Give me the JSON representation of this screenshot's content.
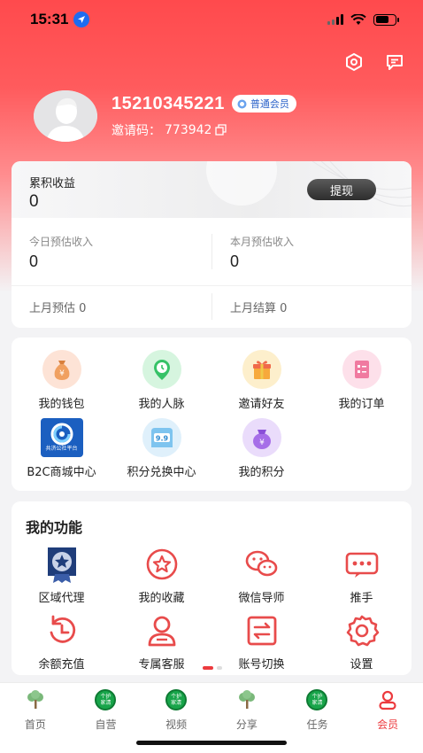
{
  "status_bar": {
    "time": "15:31"
  },
  "profile": {
    "phone": "15210345221",
    "member_level": "普通会员",
    "invite_label": "邀请码：",
    "invite_code": "773942"
  },
  "earnings": {
    "total_label": "累积收益",
    "total_value": "0",
    "withdraw_label": "提现",
    "today_label": "今日预估收入",
    "today_value": "0",
    "month_label": "本月预估收入",
    "month_value": "0",
    "last_month_estimate": "上月预估 0",
    "last_month_settled": "上月结算 0"
  },
  "menu": {
    "items": [
      {
        "label": "我的钱包",
        "icon": "money-bag-icon"
      },
      {
        "label": "我的人脉",
        "icon": "clock-pin-icon"
      },
      {
        "label": "邀请好友",
        "icon": "gift-icon"
      },
      {
        "label": "我的订单",
        "icon": "order-list-icon"
      },
      {
        "label": "B2C商城中心",
        "icon": "mall-logo-icon",
        "logo_text": "共济公社平台"
      },
      {
        "label": "积分兑换中心",
        "icon": "points-tag-icon",
        "tag_text": "9.9"
      },
      {
        "label": "我的积分",
        "icon": "points-bag-icon"
      }
    ]
  },
  "functions": {
    "title": "我的功能",
    "items": [
      {
        "label": "区域代理",
        "icon": "agent-medal-icon"
      },
      {
        "label": "我的收藏",
        "icon": "star-icon"
      },
      {
        "label": "微信导师",
        "icon": "wechat-icon"
      },
      {
        "label": "推手",
        "icon": "promoter-icon"
      },
      {
        "label": "余额充值",
        "icon": "recharge-icon"
      },
      {
        "label": "专属客服",
        "icon": "service-icon"
      },
      {
        "label": "账号切换",
        "icon": "switch-account-icon"
      },
      {
        "label": "设置",
        "icon": "gear-icon"
      }
    ]
  },
  "tabbar": {
    "tabs": [
      {
        "label": "首页",
        "icon": "tree-icon",
        "active": false
      },
      {
        "label": "自营",
        "icon": "green-badge-icon",
        "badge_text": "个护家清",
        "active": false
      },
      {
        "label": "视频",
        "icon": "green-badge-icon",
        "badge_text": "个护家清",
        "active": false
      },
      {
        "label": "分享",
        "icon": "tree-icon",
        "active": false
      },
      {
        "label": "任务",
        "icon": "green-badge-icon",
        "badge_text": "个护家清",
        "active": false
      },
      {
        "label": "会员",
        "icon": "person-icon",
        "active": true
      }
    ]
  },
  "colors": {
    "brand_red": "#ff4a4d",
    "active_tab": "#ec3a3e",
    "badge_blue": "#2b62c9",
    "green": "#18a54a"
  }
}
